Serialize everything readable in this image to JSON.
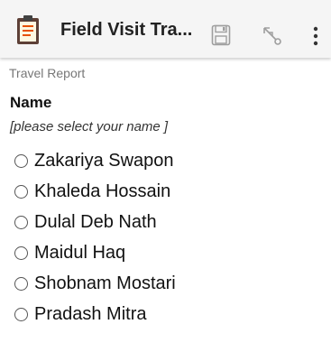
{
  "appbar": {
    "title": "Field Visit Tra...",
    "app_icon": "clipboard-icon",
    "actions": [
      "save-icon",
      "gps-icon",
      "more-vert-icon"
    ]
  },
  "form": {
    "title": "Travel Report",
    "question": {
      "label": "Name",
      "hint": "[please select your name ]",
      "options": [
        {
          "label": "Zakariya Swapon",
          "selected": false
        },
        {
          "label": "Khaleda Hossain",
          "selected": false
        },
        {
          "label": "Dulal Deb Nath",
          "selected": false
        },
        {
          "label": "Maidul Haq",
          "selected": false
        },
        {
          "label": "Shobnam Mostari",
          "selected": false
        },
        {
          "label": "Pradash Mitra",
          "selected": false
        }
      ]
    }
  }
}
